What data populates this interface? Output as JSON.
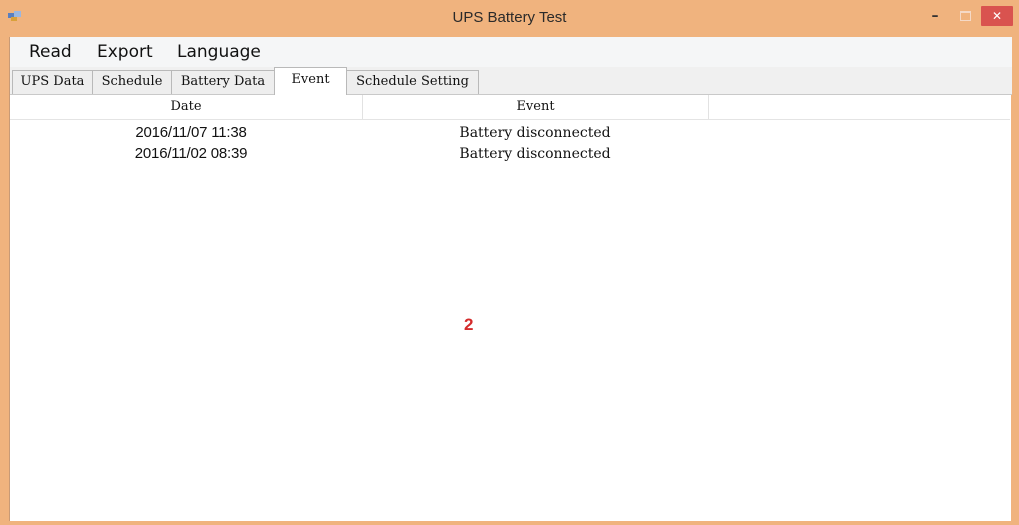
{
  "window": {
    "title": "UPS Battery Test",
    "min_glyph": "–",
    "close_glyph": "✕",
    "accent": "#f0b37e",
    "close_color": "#d9534f"
  },
  "menu": {
    "items": [
      "Read",
      "Export",
      "Language"
    ]
  },
  "tabs": {
    "items": [
      "UPS Data",
      "Schedule",
      "Battery Data",
      "Event",
      "Schedule Setting"
    ],
    "active": "Event"
  },
  "event_list": {
    "columns": [
      "Date",
      "Event",
      ""
    ],
    "rows": [
      {
        "date": "2016/11/07 11:38",
        "event": "Battery disconnected"
      },
      {
        "date": "2016/11/02 08:39",
        "event": "Battery disconnected"
      }
    ]
  },
  "annotation": {
    "marker": "2",
    "color": "#d42b2b"
  }
}
